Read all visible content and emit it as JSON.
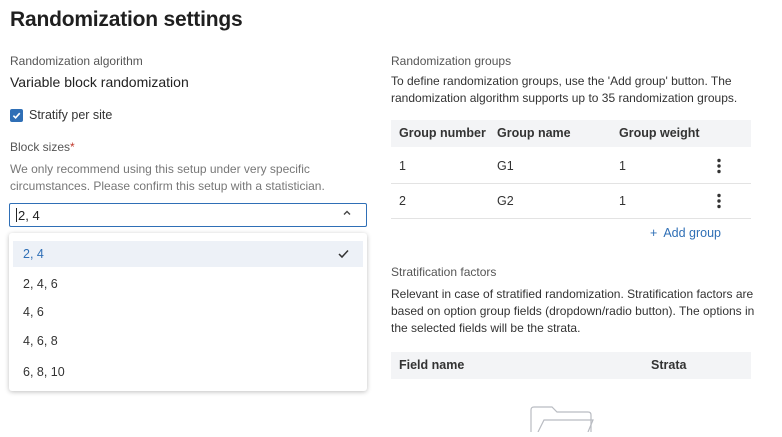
{
  "title": "Randomization settings",
  "algorithm": {
    "label": "Randomization algorithm",
    "value": "Variable block randomization"
  },
  "stratify": {
    "label": "Stratify per site",
    "checked": true
  },
  "block_sizes": {
    "label": "Block sizes",
    "required_mark": "*",
    "hint": "We only recommend using this setup under very specific circumstances. Please confirm this setup with a statistician.",
    "current_value": "2, 4",
    "options": [
      {
        "label": "2, 4",
        "selected": true
      },
      {
        "label": "2, 4, 6",
        "selected": false
      },
      {
        "label": "4, 6",
        "selected": false
      },
      {
        "label": "4, 6, 8",
        "selected": false
      },
      {
        "label": "6, 8, 10",
        "selected": false
      }
    ]
  },
  "groups": {
    "label": "Randomization groups",
    "description": "To define randomization groups, use the 'Add group' button. The randomization algorithm supports up to 35 randomization groups.",
    "columns": [
      "Group number",
      "Group name",
      "Group weight"
    ],
    "rows": [
      {
        "number": "1",
        "name": "G1",
        "weight": "1"
      },
      {
        "number": "2",
        "name": "G2",
        "weight": "1"
      }
    ],
    "add_label": "Add group"
  },
  "stratification": {
    "label": "Stratification factors",
    "description": "Relevant in case of stratified randomization. Stratification factors are based on option group fields (dropdown/radio button). The options in the selected fields will be the strata.",
    "columns": [
      "Field name",
      "Strata"
    ]
  },
  "colors": {
    "accent": "#2f6fb6",
    "header_bg": "#f3f4f6"
  }
}
